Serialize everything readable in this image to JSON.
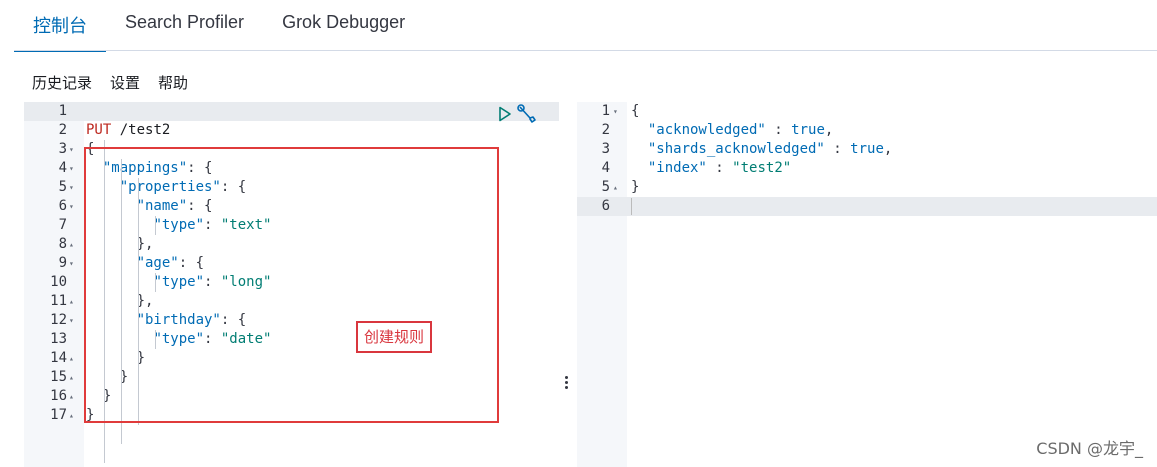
{
  "tabs": [
    {
      "label": "控制台",
      "active": true
    },
    {
      "label": "Search Profiler",
      "active": false
    },
    {
      "label": "Grok Debugger",
      "active": false
    }
  ],
  "menu": {
    "history": "历史记录",
    "settings": "设置",
    "help": "帮助"
  },
  "input_editor": {
    "lines": [
      {
        "n": "1",
        "fold": "",
        "tokens": []
      },
      {
        "n": "2",
        "fold": "",
        "tokens": [
          {
            "t": "PUT",
            "c": "t-method"
          },
          {
            "t": " /test2",
            "c": "t-url"
          }
        ]
      },
      {
        "n": "3",
        "fold": "▾",
        "tokens": [
          {
            "t": "{",
            "c": "t-punc"
          }
        ]
      },
      {
        "n": "4",
        "fold": "▾",
        "tokens": [
          {
            "t": "  ",
            "c": "t-punc"
          },
          {
            "t": "\"mappings\"",
            "c": "t-key"
          },
          {
            "t": ": {",
            "c": "t-punc"
          }
        ]
      },
      {
        "n": "5",
        "fold": "▾",
        "tokens": [
          {
            "t": "    ",
            "c": "t-punc"
          },
          {
            "t": "\"properties\"",
            "c": "t-key"
          },
          {
            "t": ": {",
            "c": "t-punc"
          }
        ]
      },
      {
        "n": "6",
        "fold": "▾",
        "tokens": [
          {
            "t": "      ",
            "c": "t-punc"
          },
          {
            "t": "\"name\"",
            "c": "t-key"
          },
          {
            "t": ": {",
            "c": "t-punc"
          }
        ]
      },
      {
        "n": "7",
        "fold": "",
        "tokens": [
          {
            "t": "        ",
            "c": "t-punc"
          },
          {
            "t": "\"type\"",
            "c": "t-key"
          },
          {
            "t": ": ",
            "c": "t-punc"
          },
          {
            "t": "\"text\"",
            "c": "t-str"
          }
        ]
      },
      {
        "n": "8",
        "fold": "▴",
        "tokens": [
          {
            "t": "      },",
            "c": "t-punc"
          }
        ]
      },
      {
        "n": "9",
        "fold": "▾",
        "tokens": [
          {
            "t": "      ",
            "c": "t-punc"
          },
          {
            "t": "\"age\"",
            "c": "t-key"
          },
          {
            "t": ": {",
            "c": "t-punc"
          }
        ]
      },
      {
        "n": "10",
        "fold": "",
        "tokens": [
          {
            "t": "        ",
            "c": "t-punc"
          },
          {
            "t": "\"type\"",
            "c": "t-key"
          },
          {
            "t": ": ",
            "c": "t-punc"
          },
          {
            "t": "\"long\"",
            "c": "t-str"
          }
        ]
      },
      {
        "n": "11",
        "fold": "▴",
        "tokens": [
          {
            "t": "      },",
            "c": "t-punc"
          }
        ]
      },
      {
        "n": "12",
        "fold": "▾",
        "tokens": [
          {
            "t": "      ",
            "c": "t-punc"
          },
          {
            "t": "\"birthday\"",
            "c": "t-key"
          },
          {
            "t": ": {",
            "c": "t-punc"
          }
        ]
      },
      {
        "n": "13",
        "fold": "",
        "tokens": [
          {
            "t": "        ",
            "c": "t-punc"
          },
          {
            "t": "\"type\"",
            "c": "t-key"
          },
          {
            "t": ": ",
            "c": "t-punc"
          },
          {
            "t": "\"date\"",
            "c": "t-str"
          }
        ]
      },
      {
        "n": "14",
        "fold": "▴",
        "tokens": [
          {
            "t": "      }",
            "c": "t-punc"
          }
        ]
      },
      {
        "n": "15",
        "fold": "▴",
        "tokens": [
          {
            "t": "    }",
            "c": "t-punc"
          }
        ]
      },
      {
        "n": "16",
        "fold": "▴",
        "tokens": [
          {
            "t": "  }",
            "c": "t-punc"
          }
        ]
      },
      {
        "n": "17",
        "fold": "▴",
        "tokens": [
          {
            "t": "}",
            "c": "t-punc"
          }
        ]
      }
    ]
  },
  "output_editor": {
    "lines": [
      {
        "n": "1",
        "fold": "▾",
        "tokens": [
          {
            "t": "{",
            "c": "t-punc"
          }
        ]
      },
      {
        "n": "2",
        "fold": "",
        "tokens": [
          {
            "t": "  ",
            "c": "t-punc"
          },
          {
            "t": "\"acknowledged\"",
            "c": "t-key"
          },
          {
            "t": " : ",
            "c": "t-punc"
          },
          {
            "t": "true",
            "c": "t-bool"
          },
          {
            "t": ",",
            "c": "t-punc"
          }
        ]
      },
      {
        "n": "3",
        "fold": "",
        "tokens": [
          {
            "t": "  ",
            "c": "t-punc"
          },
          {
            "t": "\"shards_acknowledged\"",
            "c": "t-key"
          },
          {
            "t": " : ",
            "c": "t-punc"
          },
          {
            "t": "true",
            "c": "t-bool"
          },
          {
            "t": ",",
            "c": "t-punc"
          }
        ]
      },
      {
        "n": "4",
        "fold": "",
        "tokens": [
          {
            "t": "  ",
            "c": "t-punc"
          },
          {
            "t": "\"index\"",
            "c": "t-key"
          },
          {
            "t": " : ",
            "c": "t-punc"
          },
          {
            "t": "\"test2\"",
            "c": "t-str"
          }
        ]
      },
      {
        "n": "5",
        "fold": "▴",
        "tokens": [
          {
            "t": "}",
            "c": "t-punc"
          }
        ]
      },
      {
        "n": "6",
        "fold": "",
        "tokens": []
      }
    ]
  },
  "annotation": {
    "label": "创建规则",
    "color": "#d9363e"
  },
  "watermark": "CSDN @龙宇_",
  "icons": {
    "run": "play-icon",
    "settings": "wrench-icon"
  },
  "colors": {
    "accent": "#006bb4",
    "method": "#bd271e",
    "string": "#017d73",
    "annotation": "#e03b3b"
  }
}
